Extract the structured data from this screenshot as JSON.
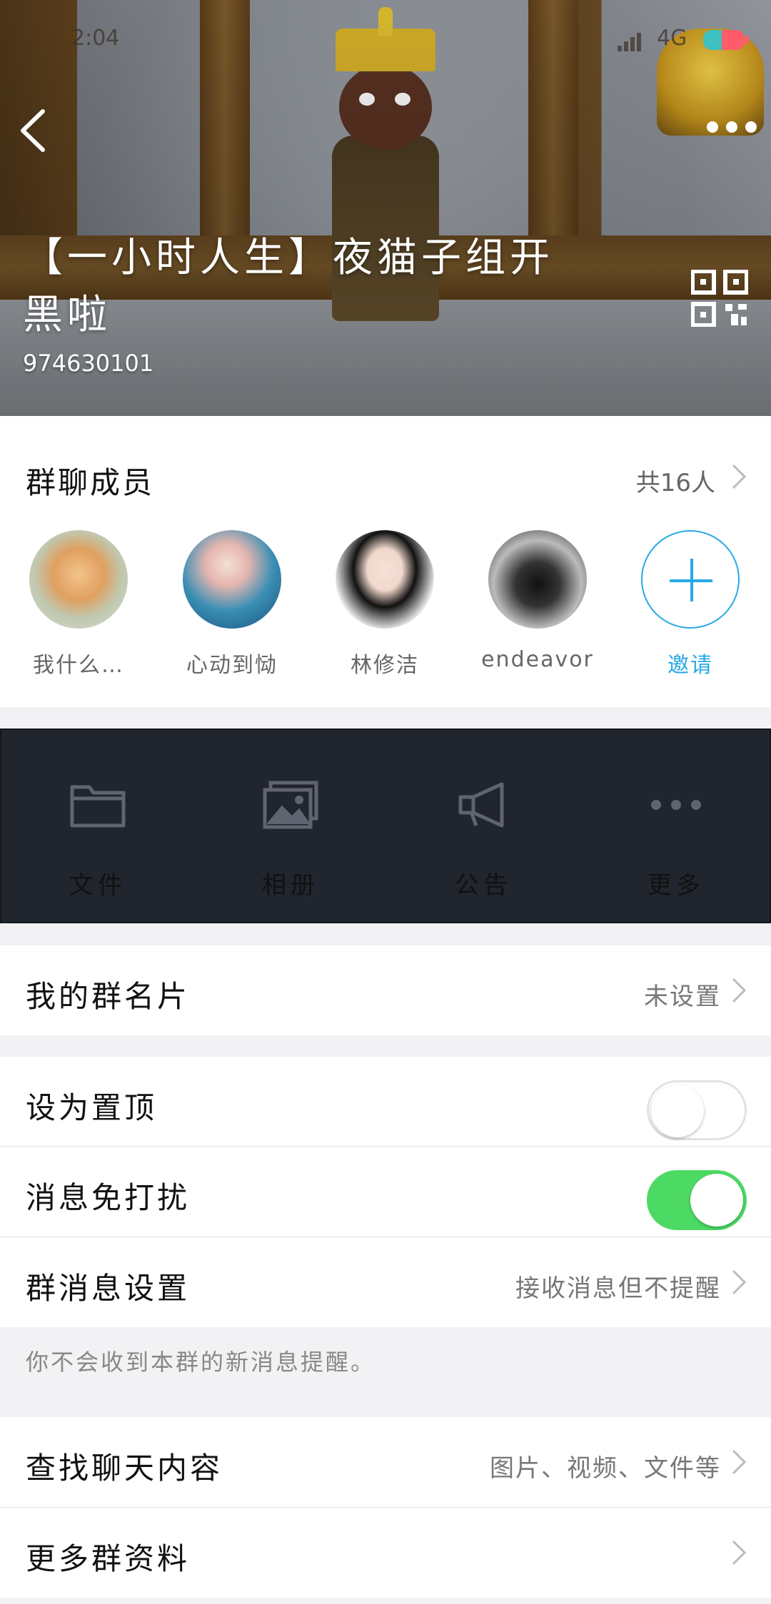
{
  "status_bar": {
    "time": "2:04",
    "network": "4G"
  },
  "header": {
    "title": "【一小时人生】夜猫子组开黑啦",
    "group_id": "974630101"
  },
  "members": {
    "label": "群聊成员",
    "count_text": "共16人",
    "list": [
      {
        "name": "我什么…"
      },
      {
        "name": "心动到恸"
      },
      {
        "name": "林修洁"
      },
      {
        "name": "endeavor"
      }
    ],
    "invite_label": "邀请"
  },
  "functions": [
    {
      "label": "文件",
      "icon": "folder-icon"
    },
    {
      "label": "相册",
      "icon": "photo-album-icon"
    },
    {
      "label": "公告",
      "icon": "megaphone-icon"
    },
    {
      "label": "更多",
      "icon": "more-dots-icon"
    }
  ],
  "my_card": {
    "label": "我的群名片",
    "value": "未设置"
  },
  "pin_top": {
    "label": "设为置顶",
    "on": false
  },
  "mute": {
    "label": "消息免打扰",
    "on": true
  },
  "msg_settings": {
    "label": "群消息设置",
    "value": "接收消息但不提醒"
  },
  "hint": "你不会收到本群的新消息提醒。",
  "search_history": {
    "label": "查找聊天内容",
    "value": "图片、视频、文件等"
  },
  "more_info": {
    "label": "更多群资料"
  },
  "colors": {
    "accent": "#27a9e6",
    "toggle_on": "#4cd964",
    "func_bar": "#21252e"
  }
}
